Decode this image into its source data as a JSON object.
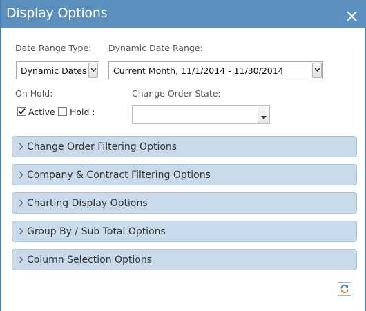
{
  "dialog": {
    "title": "Display Options"
  },
  "filters": {
    "date_range_type_label": "Date Range Type:",
    "date_range_type_value": "Dynamic Dates",
    "dynamic_date_range_label": "Dynamic Date Range:",
    "dynamic_date_range_value": "Current Month, 11/1/2014 - 11/30/2014",
    "on_hold_label": "On Hold:",
    "active_label": "Active",
    "active_checked": true,
    "hold_label": "Hold :",
    "hold_checked": false,
    "change_order_state_label": "Change Order State:",
    "change_order_state_value": ""
  },
  "sections": [
    {
      "label": "Change Order Filtering Options"
    },
    {
      "label": "Company & Contract Filtering Options"
    },
    {
      "label": "Charting Display Options"
    },
    {
      "label": "Group By / Sub Total Options"
    },
    {
      "label": "Column Selection Options"
    }
  ],
  "icons": {
    "close": "close-icon",
    "refresh": "refresh-icon",
    "section_chevron": "chevron-right-icon"
  },
  "colors": {
    "titlebar": "#5b8fbd",
    "section_bg": "#c9dbeb",
    "section_border": "#aac3dc"
  }
}
